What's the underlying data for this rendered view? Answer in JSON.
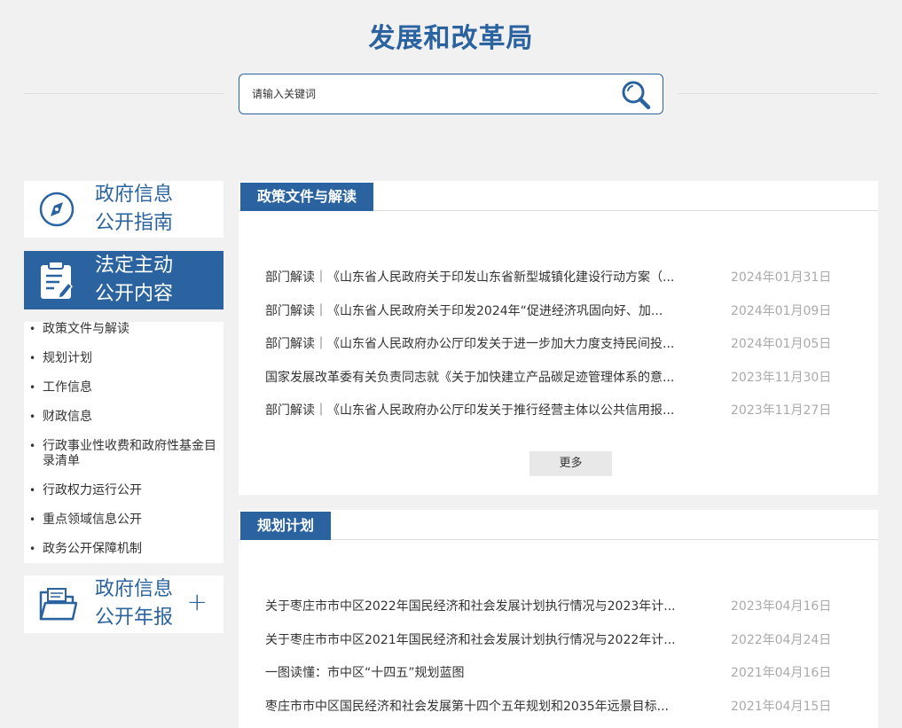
{
  "header": {
    "title": "发展和改革局",
    "search_placeholder": "请输入关键词",
    "search_icon": "search-icon"
  },
  "sidebar": {
    "guide": {
      "label": "政府信息\n公开指南",
      "icon": "compass-icon"
    },
    "content": {
      "label": "法定主动\n公开内容",
      "icon": "clipboard-icon"
    },
    "annual": {
      "label": "政府信息\n公开年报",
      "icon": "folder-icon",
      "expand": "+"
    },
    "items": [
      {
        "label": "政策文件与解读"
      },
      {
        "label": "规划计划"
      },
      {
        "label": "工作信息"
      },
      {
        "label": "财政信息"
      },
      {
        "label": "行政事业性收费和政府性基金目录清单"
      },
      {
        "label": "行政权力运行公开"
      },
      {
        "label": "重点领域信息公开"
      },
      {
        "label": "政务公开保障机制"
      }
    ]
  },
  "sections": [
    {
      "title": "政策文件与解读",
      "more": "更多",
      "rows": [
        {
          "title": "部门解读｜《山东省人民政府关于印发山东省新型城镇化建设行动方案（...",
          "date": "2024年01月31日"
        },
        {
          "title": "部门解读｜《山东省人民政府关于印发2024年“促进经济巩固向好、加...",
          "date": "2024年01月09日"
        },
        {
          "title": "部门解读｜《山东省人民政府办公厅印发关于进一步加大力度支持民间投...",
          "date": "2024年01月05日"
        },
        {
          "title": "国家发展改革委有关负责同志就《关于加快建立产品碳足迹管理体系的意...",
          "date": "2023年11月30日"
        },
        {
          "title": "部门解读｜《山东省人民政府办公厅印发关于推行经营主体以公共信用报...",
          "date": "2023年11月27日"
        }
      ]
    },
    {
      "title": "规划计划",
      "rows": [
        {
          "title": "关于枣庄市市中区2022年国民经济和社会发展计划执行情况与2023年计...",
          "date": "2023年04月16日"
        },
        {
          "title": "关于枣庄市市中区2021年国民经济和社会发展计划执行情况与2022年计...",
          "date": "2022年04月24日"
        },
        {
          "title": "一图读懂：市中区“十四五”规划蓝图",
          "date": "2021年04月16日"
        },
        {
          "title": "枣庄市市中区国民经济和社会发展第十四个五年规划和2035年远景目标...",
          "date": "2021年04月15日"
        }
      ]
    }
  ]
}
